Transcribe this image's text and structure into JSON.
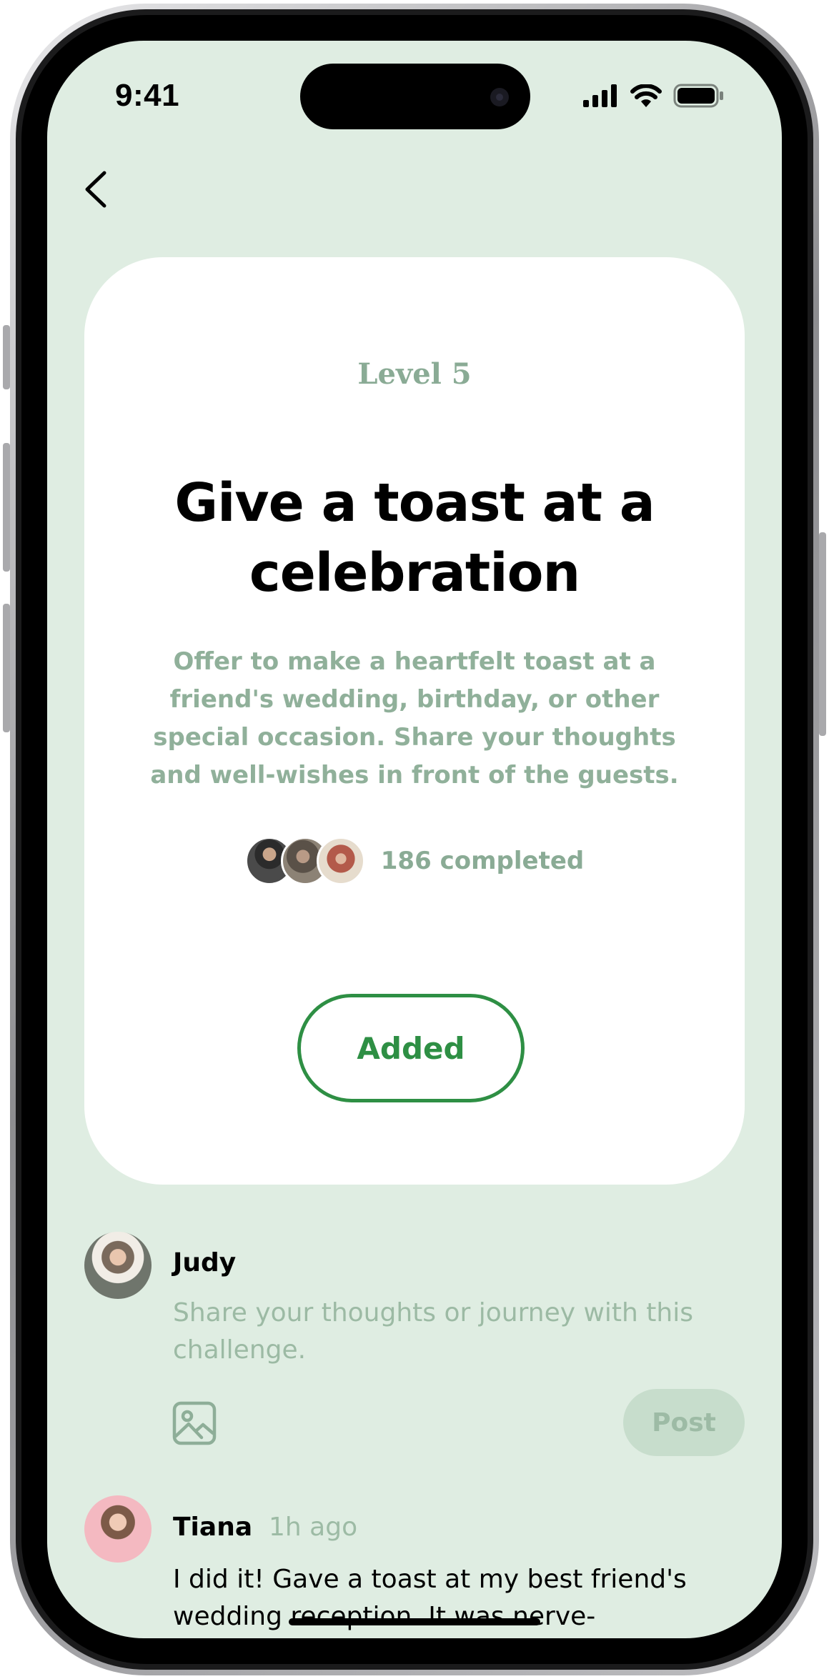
{
  "status_bar": {
    "time": "9:41"
  },
  "challenge": {
    "level": "Level 5",
    "title": "Give a toast at a celebration",
    "description": "Offer to make a heartfelt toast at a friend's wedding, birthday, or other special occasion. Share your thoughts and well-wishes in front of the guests.",
    "completed_label": "186 completed",
    "added_button": "Added"
  },
  "composer": {
    "user_name": "Judy",
    "placeholder": "Share your thoughts or journey with this challenge.",
    "post_button": "Post"
  },
  "feed": [
    {
      "user_name": "Tiana",
      "time_ago": "1h ago",
      "text": "I did it! Gave a toast at my best friend's wedding reception. It was nerve-"
    }
  ],
  "colors": {
    "screen_bg": "#dfede2",
    "accent_green": "#2e8f44",
    "muted_green": "#8aab95",
    "post_button_bg": "#c7ddcc"
  },
  "icons": [
    "back-chevron-icon",
    "signal-icon",
    "wifi-icon",
    "battery-icon",
    "image-icon"
  ]
}
